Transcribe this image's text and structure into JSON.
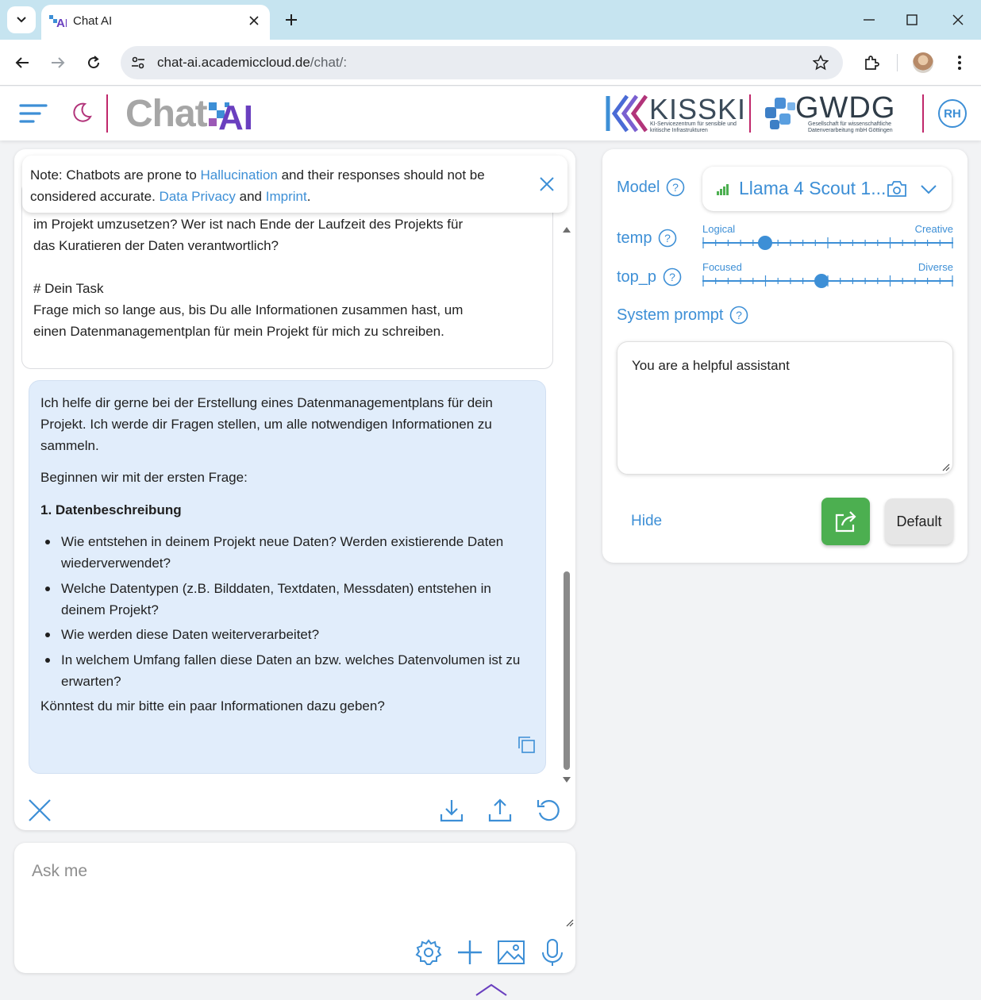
{
  "browser": {
    "tab_title": "Chat AI",
    "url_host": "chat-ai.academiccloud.de",
    "url_path": "/chat/:"
  },
  "header": {
    "logo_text": "Chat",
    "logo_ai": "AI",
    "kisski_name": "KISSKI",
    "kisski_sub": "KI-Servicezentrum für sensible und kritische Infrastrukturen",
    "gwdg_name": "GWDG",
    "gwdg_sub": "Gesellschaft für wissenschaftliche Datenverarbeitung mbH Göttingen",
    "avatar_initials": "RH",
    "accent_color": "#3d8fd6",
    "brand_divider_color": "#c0276b"
  },
  "notice": {
    "prefix": "Note: Chatbots are prone to ",
    "hallucination_link": "Hallucination",
    "middle": " and their responses should not be considered accurate. ",
    "privacy_link": "Data Privacy",
    "and": " and ",
    "imprint_link": "Imprint",
    "suffix": "."
  },
  "chat": {
    "user_message": "Wer kümmert sich um das Datenmanagement? Welche Ressourcen\nsind erforderlich, um einen adäquaten Umgang mit Forschungsdaten\nim Projekt umzusetzen? Wer ist nach Ende der Laufzeit des Projekts für\ndas Kuratieren der Daten verantwortlich?\n\n# Dein Task\nFrage mich so lange aus, bis Du alle Informationen zusammen hast, um\neinen Datenmanagementplan für mein Projekt für mich zu schreiben.",
    "ai_intro": "Ich helfe dir gerne bei der Erstellung eines Datenmanagementplans für dein Projekt. Ich werde dir Fragen stellen, um alle notwendigen Informationen zu sammeln.",
    "ai_start": "Beginnen wir mit der ersten Frage:",
    "ai_heading": "1. Datenbeschreibung",
    "ai_bullets": [
      "Wie entstehen in deinem Projekt neue Daten? Werden existierende Daten wiederverwendet?",
      "Welche Datentypen (z.B. Bilddaten, Textdaten, Messdaten) entstehen in deinem Projekt?",
      "Wie werden diese Daten weiterverarbeitet?",
      "In welchem Umfang fallen diese Daten an bzw. welches Datenvolumen ist zu erwarten?"
    ],
    "ai_closing": "Könntest du mir bitte ein paar Informationen dazu geben?"
  },
  "input": {
    "placeholder": "Ask me"
  },
  "settings": {
    "model_label": "Model",
    "model_value": "Llama 4 Scout 1...",
    "temp_label": "temp",
    "temp_left": "Logical",
    "temp_right": "Creative",
    "temp_value_fraction": 0.25,
    "top_p_label": "top_p",
    "top_p_left": "Focused",
    "top_p_right": "Diverse",
    "top_p_value_fraction": 0.475,
    "system_prompt_label": "System prompt",
    "system_prompt_value": "You are a helpful assistant",
    "hide_label": "Hide",
    "default_label": "Default",
    "share_color": "#4caf50"
  }
}
